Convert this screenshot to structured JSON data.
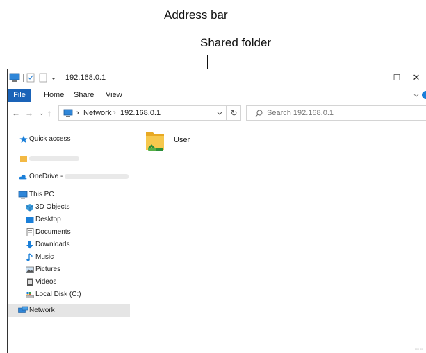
{
  "annotations": {
    "address_bar": "Address bar",
    "shared_folder": "Shared folder"
  },
  "window": {
    "title": "192.168.0.1",
    "minimize": "–",
    "maximize": "☐",
    "close": "✕"
  },
  "ribbon": {
    "tabs": [
      "File",
      "Home",
      "Share",
      "View"
    ]
  },
  "address": {
    "crumbs": [
      "Network",
      "192.168.0.1"
    ],
    "separator": "›"
  },
  "search": {
    "placeholder": "Search 192.168.0.1"
  },
  "sidebar": {
    "quick_access": "Quick access",
    "onedrive": "OneDrive -",
    "this_pc": "This PC",
    "items": [
      "3D Objects",
      "Desktop",
      "Documents",
      "Downloads",
      "Music",
      "Pictures",
      "Videos",
      "Local Disk (C:)"
    ],
    "network": "Network"
  },
  "content": {
    "folder_name": "User"
  },
  "colors": {
    "accent": "#1a63b8",
    "selected_row": "#e5e5e5"
  }
}
